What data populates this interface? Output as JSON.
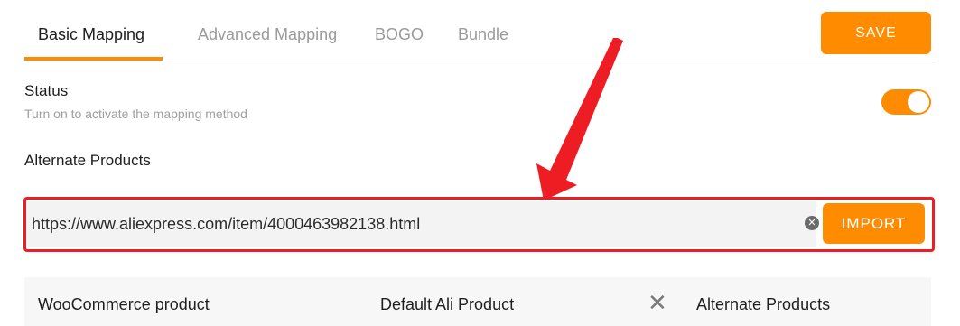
{
  "tabs": [
    {
      "label": "Basic Mapping",
      "active": true
    },
    {
      "label": "Advanced Mapping",
      "active": false
    },
    {
      "label": "BOGO",
      "active": false
    },
    {
      "label": "Bundle",
      "active": false
    }
  ],
  "save_label": "SAVE",
  "status": {
    "title": "Status",
    "description": "Turn on to activate the mapping method",
    "enabled": true
  },
  "alternate_products": {
    "title": "Alternate Products",
    "url_value": "https://www.aliexpress.com/item/4000463982138.html",
    "import_label": "IMPORT"
  },
  "table": {
    "headers": [
      "WooCommerce product",
      "Default Ali Product",
      "Alternate Products"
    ]
  },
  "colors": {
    "accent": "#ff8c00",
    "annotation": "#ee1d24"
  }
}
